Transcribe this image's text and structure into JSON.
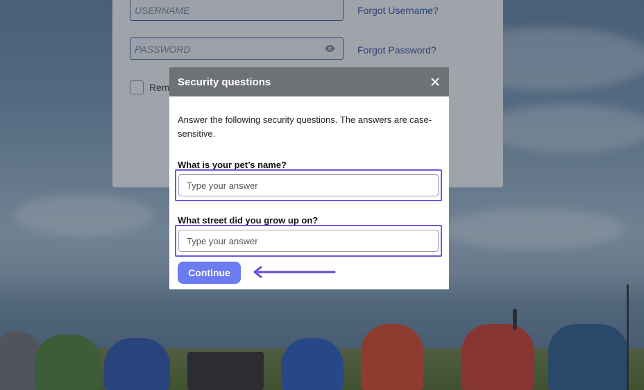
{
  "login": {
    "username_placeholder": "USERNAME",
    "password_placeholder": "PASSWORD",
    "forgot_username": "Forgot Username?",
    "forgot_password": "Forgot Password?",
    "remember_label": "Rem"
  },
  "modal": {
    "title": "Security questions",
    "close_icon": "close-icon",
    "intro": "Answer the following security questions. The answers are case-sensitive.",
    "questions": [
      {
        "label": "What is your pet’s name?",
        "placeholder": "Type your answer",
        "value": ""
      },
      {
        "label": "What street did you grow up on?",
        "placeholder": "Type your answer",
        "value": ""
      }
    ],
    "continue_label": "Continue"
  },
  "colors": {
    "header_bg": "#6e7176",
    "accent": "#6a5ae0",
    "button_bg": "#6a7cf0",
    "link": "#2f4fa0"
  }
}
